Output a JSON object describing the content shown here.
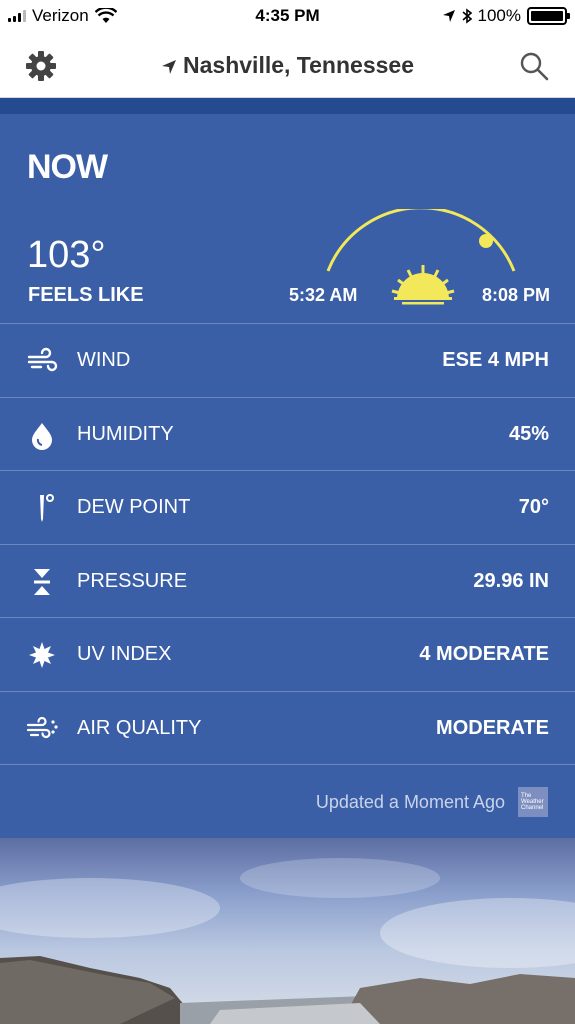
{
  "status_bar": {
    "carrier": "Verizon",
    "time": "4:35 PM",
    "battery": "100%"
  },
  "header": {
    "location": "Nashville, Tennessee"
  },
  "now": {
    "title": "NOW",
    "temperature": "103°",
    "feels_like_label": "FEELS LIKE",
    "sunrise": "5:32 AM",
    "sunset": "8:08 PM"
  },
  "conditions": [
    {
      "icon": "wind-icon",
      "label": "WIND",
      "value": "ESE 4 MPH"
    },
    {
      "icon": "humidity-drop-icon",
      "label": "HUMIDITY",
      "value": "45%"
    },
    {
      "icon": "thermometer-icon",
      "label": "DEW POINT",
      "value": "70°"
    },
    {
      "icon": "pressure-icon",
      "label": "PRESSURE",
      "value": "29.96 IN"
    },
    {
      "icon": "uv-sun-icon",
      "label": "UV INDEX",
      "value": "4 MODERATE"
    },
    {
      "icon": "air-quality-icon",
      "label": "AIR QUALITY",
      "value": "MODERATE"
    }
  ],
  "footer": {
    "updated": "Updated a Moment Ago",
    "logo_text": "The Weather Channel"
  },
  "colors": {
    "card": "#3a5fa7",
    "band": "#244b8f",
    "sun": "#f2e85a"
  }
}
